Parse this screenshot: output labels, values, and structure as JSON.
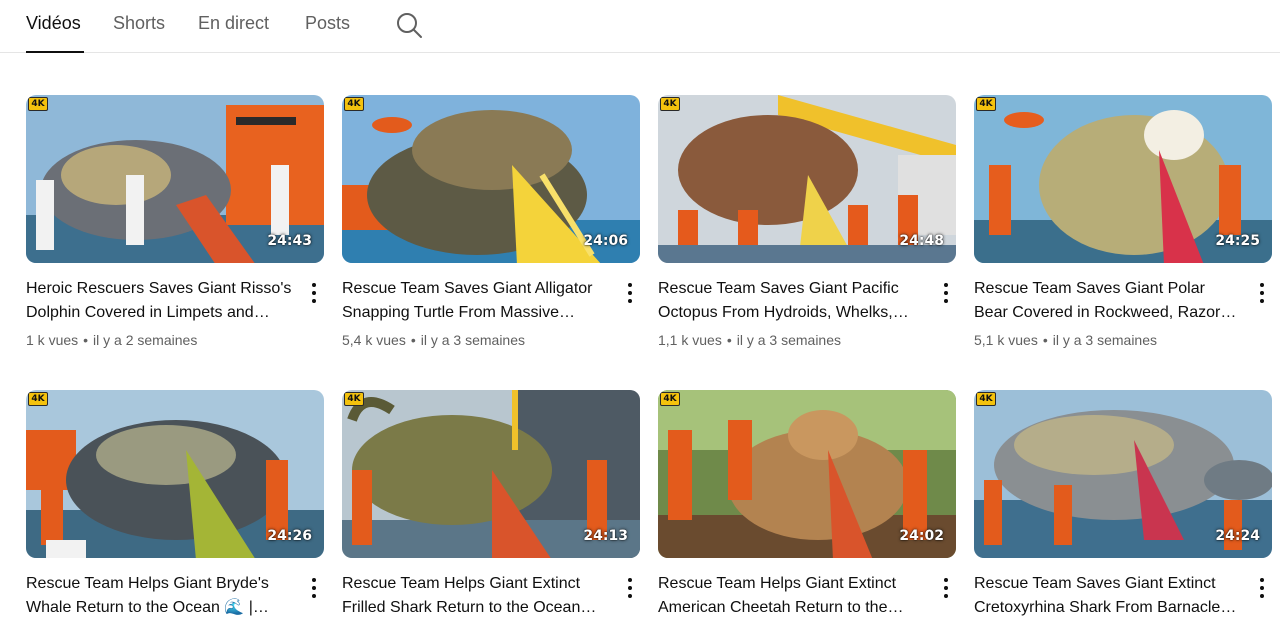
{
  "tabs": {
    "videos": "Vidéos",
    "shorts": "Shorts",
    "live": "En direct",
    "posts": "Posts",
    "search_icon": "search-icon"
  },
  "colors": {
    "text_primary": "#0f0f0f",
    "text_secondary": "#606060",
    "divider": "#e5e5e5",
    "badge_4k": "#f4c20d"
  },
  "videos": [
    {
      "badge": "4K",
      "duration": "24:43",
      "title_line1": "Heroic Rescuers Saves Giant Risso's",
      "title_line2": "Dolphin Covered in Limpets and…",
      "views": "1 k vues",
      "age": "il y a 2 semaines"
    },
    {
      "badge": "4K",
      "duration": "24:06",
      "title_line1": "Rescue Team Saves Giant Alligator",
      "title_line2": "Snapping Turtle From Massive…",
      "views": "5,4 k vues",
      "age": "il y a 3 semaines"
    },
    {
      "badge": "4K",
      "duration": "24:48",
      "title_line1": "Rescue Team Saves Giant Pacific",
      "title_line2": "Octopus From Hydroids, Whelks,…",
      "views": "1,1 k vues",
      "age": "il y a 3 semaines"
    },
    {
      "badge": "4K",
      "duration": "24:25",
      "title_line1": "Rescue Team Saves Giant Polar",
      "title_line2": "Bear Covered in Rockweed, Razor…",
      "views": "5,1 k vues",
      "age": "il y a 3 semaines"
    },
    {
      "badge": "4K",
      "duration": "24:26",
      "title_line1": "Rescue Team Helps Giant Bryde's",
      "title_line2": "Whale Return to the Ocean 🌊 |…",
      "views": "",
      "age": ""
    },
    {
      "badge": "4K",
      "duration": "24:13",
      "title_line1": "Rescue Team Helps Giant Extinct",
      "title_line2": "Frilled Shark Return to the Ocean…",
      "views": "",
      "age": ""
    },
    {
      "badge": "4K",
      "duration": "24:02",
      "title_line1": "Rescue Team Helps Giant Extinct",
      "title_line2": "American Cheetah Return to the…",
      "views": "",
      "age": ""
    },
    {
      "badge": "4K",
      "duration": "24:24",
      "title_line1": "Rescue Team Saves Giant Extinct",
      "title_line2": "Cretoxyrhina Shark From Barnacle…",
      "views": "",
      "age": ""
    }
  ],
  "meta_separator": "•"
}
